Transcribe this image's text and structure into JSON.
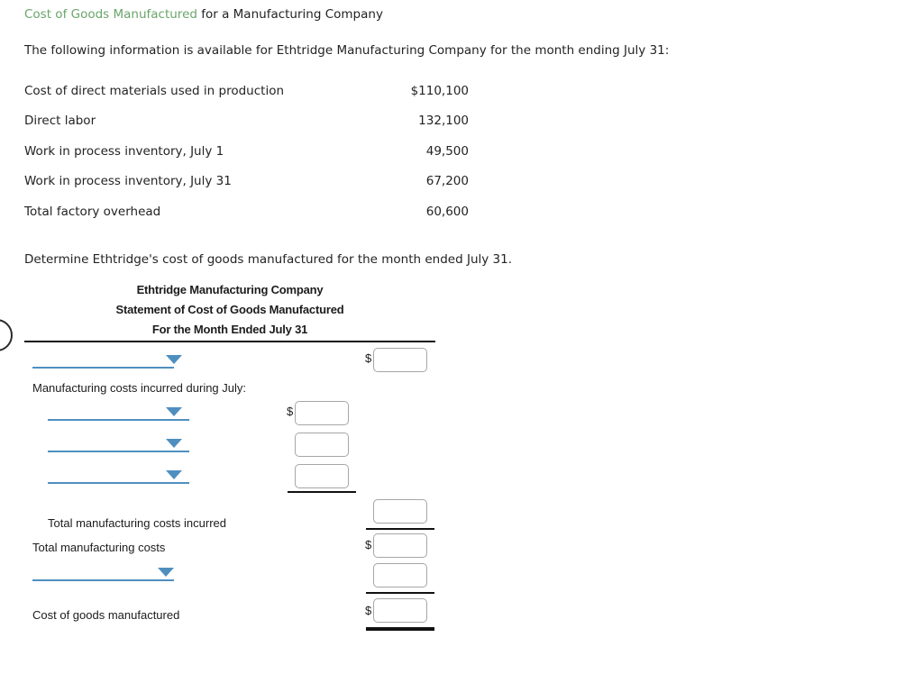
{
  "problem": {
    "title_highlight": "Cost of Goods Manufactured",
    "title_rest": " for a Manufacturing Company",
    "intro": "The following information is available for Ethtridge Manufacturing Company for the month ending July 31:",
    "facts": [
      {
        "label": "Cost of direct materials used in production",
        "amount": "$110,100"
      },
      {
        "label": "Direct labor",
        "amount": "132,100"
      },
      {
        "label": "Work in process inventory, July 1",
        "amount": "49,500"
      },
      {
        "label": "Work in process inventory, July 31",
        "amount": "67,200"
      },
      {
        "label": "Total factory overhead",
        "amount": "60,600"
      }
    ],
    "ask": "Determine Ethtridge's cost of goods manufactured for the month ended July 31."
  },
  "statement": {
    "heading_line1": "Ethtridge Manufacturing Company",
    "heading_line2": "Statement of Cost of Goods Manufactured",
    "heading_line3": "For the Month Ended July 31",
    "labels": {
      "manufacturing_costs_incurred": "Manufacturing costs incurred during July:",
      "total_manufacturing_costs_incurred": "Total manufacturing costs incurred",
      "total_manufacturing_costs": "Total manufacturing costs",
      "cost_of_goods_manufactured": "Cost of goods manufactured"
    },
    "dollar_sign": "$",
    "dropdowns": [
      {
        "name": "beginning-work-in-process",
        "value": ""
      },
      {
        "name": "cost-item-1",
        "value": ""
      },
      {
        "name": "cost-item-2",
        "value": ""
      },
      {
        "name": "cost-item-3",
        "value": ""
      },
      {
        "name": "ending-work-in-process",
        "value": ""
      }
    ],
    "inputs": [
      {
        "name": "beginning-wip-amount",
        "value": ""
      },
      {
        "name": "cost-item-1-amount",
        "value": ""
      },
      {
        "name": "cost-item-2-amount",
        "value": ""
      },
      {
        "name": "cost-item-3-amount",
        "value": ""
      },
      {
        "name": "total-manufacturing-costs-incurred-amount",
        "value": ""
      },
      {
        "name": "total-manufacturing-costs-amount",
        "value": ""
      },
      {
        "name": "ending-wip-amount",
        "value": ""
      },
      {
        "name": "cost-of-goods-manufactured-amount",
        "value": ""
      }
    ]
  },
  "colors": {
    "title_green": "#6aa56a",
    "dropdown_blue": "#4f8fc0",
    "rule_black": "#111111",
    "box_border": "#a6a6a6"
  }
}
